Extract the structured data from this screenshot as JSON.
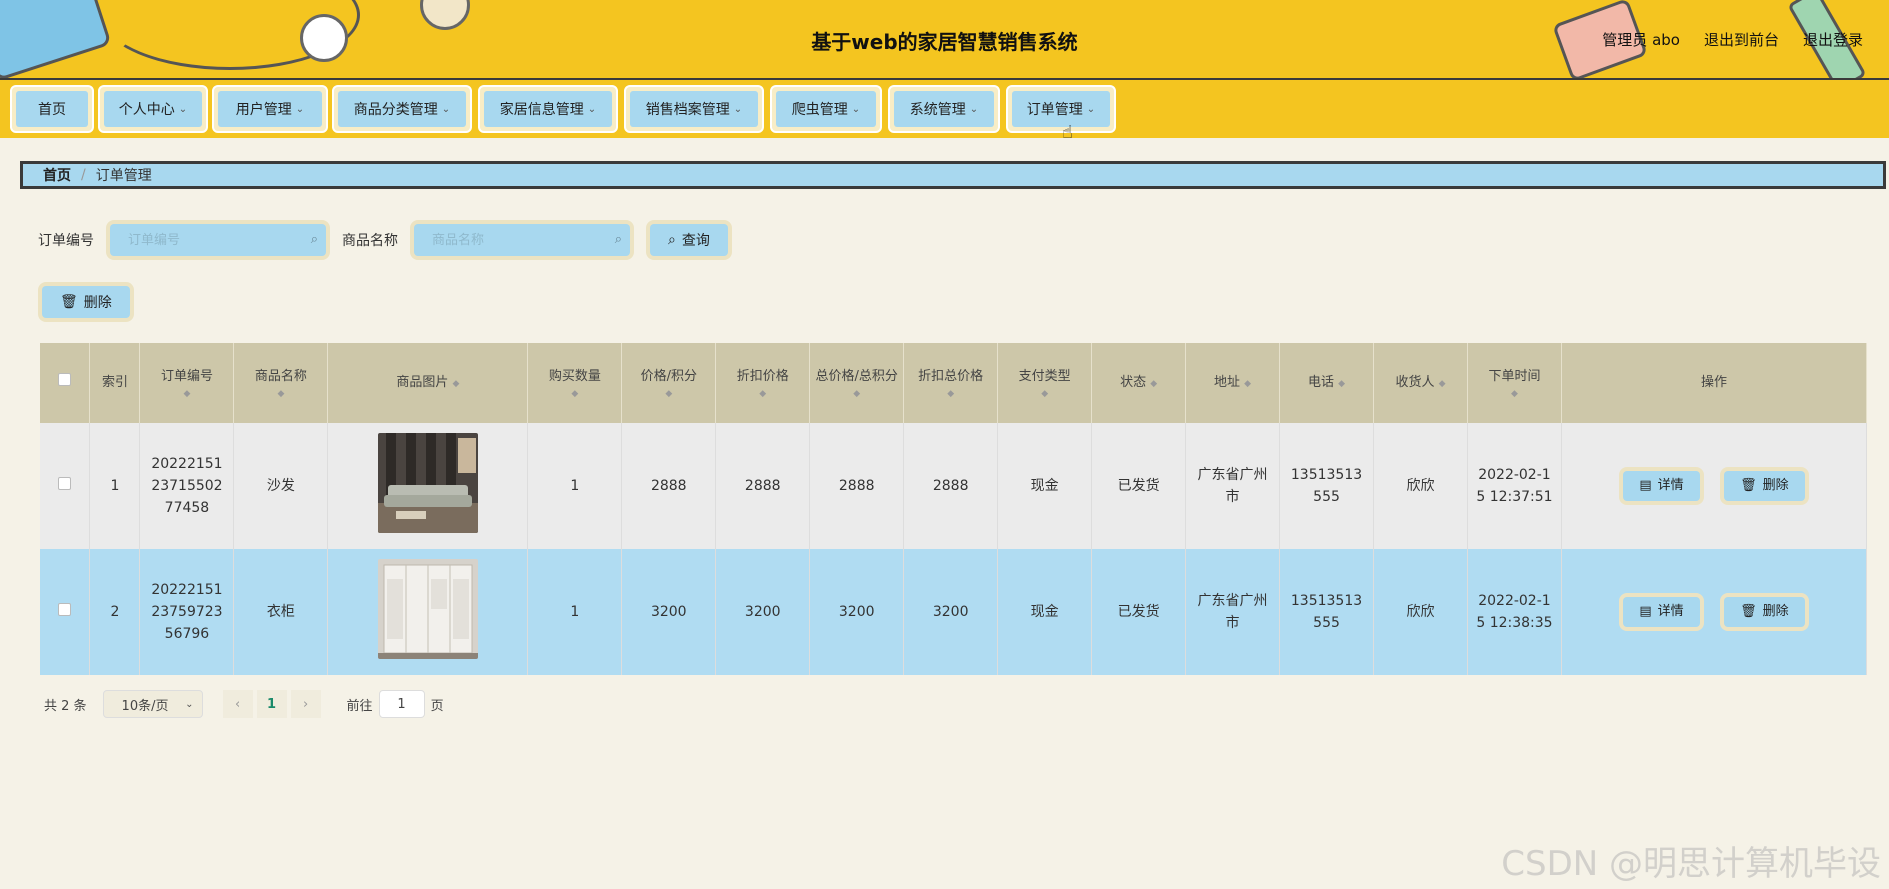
{
  "header": {
    "title": "基于web的家居智慧销售系统",
    "user_label": "管理员 abo",
    "links": [
      "退出到前台",
      "退出登录"
    ]
  },
  "nav": {
    "items": [
      {
        "label": "首页",
        "has_dropdown": false
      },
      {
        "label": "个人中心",
        "has_dropdown": true
      },
      {
        "label": "用户管理",
        "has_dropdown": true
      },
      {
        "label": "商品分类管理",
        "has_dropdown": true
      },
      {
        "label": "家居信息管理",
        "has_dropdown": true
      },
      {
        "label": "销售档案管理",
        "has_dropdown": true
      },
      {
        "label": "爬虫管理",
        "has_dropdown": true
      },
      {
        "label": "系统管理",
        "has_dropdown": true
      },
      {
        "label": "订单管理",
        "has_dropdown": true
      }
    ]
  },
  "breadcrumb": {
    "home": "首页",
    "separator": "/",
    "current": "订单管理"
  },
  "search": {
    "order_no_label": "订单编号",
    "order_no_placeholder": "订单编号",
    "product_label": "商品名称",
    "product_placeholder": "商品名称",
    "query_button": "查询"
  },
  "toolbar": {
    "delete_button": "删除"
  },
  "table": {
    "columns": [
      "索引",
      "订单编号",
      "商品名称",
      "商品图片",
      "购买数量",
      "价格/积分",
      "折扣价格",
      "总价格/总积分",
      "折扣总价格",
      "支付类型",
      "状态",
      "地址",
      "电话",
      "收货人",
      "下单时间",
      "操作"
    ],
    "rows": [
      {
        "index": "1",
        "order_no": "2022215123715502 77458",
        "order_no_lines": [
          "20222151",
          "23715502",
          "77458"
        ],
        "product": "沙发",
        "image": "sofa-image",
        "qty": "1",
        "price": "2888",
        "discount_price": "2888",
        "total": "2888",
        "discount_total": "2888",
        "pay_type": "现金",
        "status": "已发货",
        "address_lines": [
          "广东省广州",
          "市"
        ],
        "phone_lines": [
          "13513513",
          "555"
        ],
        "receiver": "欣欣",
        "time_lines": [
          "2022-02-1",
          "5 12:37:51"
        ],
        "detail_button": "详情",
        "delete_button": "删除"
      },
      {
        "index": "2",
        "order_no_lines": [
          "20222151",
          "23759723",
          "56796"
        ],
        "product": "衣柜",
        "image": "wardrobe-image",
        "qty": "1",
        "price": "3200",
        "discount_price": "3200",
        "total": "3200",
        "discount_total": "3200",
        "pay_type": "现金",
        "status": "已发货",
        "address_lines": [
          "广东省广州",
          "市"
        ],
        "phone_lines": [
          "13513513",
          "555"
        ],
        "receiver": "欣欣",
        "time_lines": [
          "2022-02-1",
          "5 12:38:35"
        ],
        "detail_button": "详情",
        "delete_button": "删除"
      }
    ]
  },
  "pager": {
    "total": "共 2 条",
    "page_size": "10条/页",
    "current_page": "1",
    "goto_label": "前往",
    "goto_value": "1",
    "page_suffix": "页"
  },
  "watermark": "CSDN @明思计算机毕设",
  "colors": {
    "header_bg": "#f4c520",
    "accent_blue": "#a8d8ef",
    "table_header": "#cdc7a9",
    "selected_row": "#b0dcf2"
  }
}
